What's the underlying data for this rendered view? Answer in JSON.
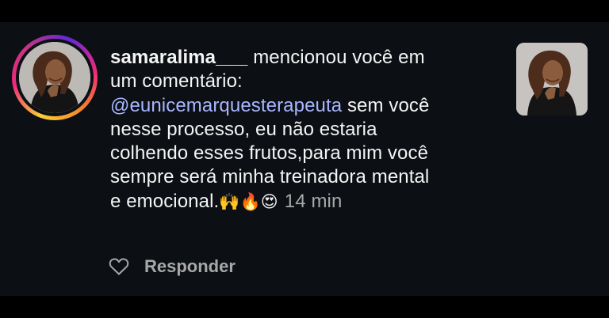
{
  "notification": {
    "username": "samaralima___",
    "action_text": " mencionou você em",
    "action_text_2": "um comentário:",
    "mention": "@eunicemarquesterapeuta",
    "comment_line_1": " sem você",
    "comment_line_2": "nesse processo, eu não estaria",
    "comment_line_3": "colhendo esses frutos,para mim você",
    "comment_line_4": "sempre será minha treinadora mental",
    "comment_line_5": "e emocional.",
    "emojis": [
      "🙌",
      "🔥",
      "😍"
    ],
    "time": "14 min"
  },
  "actions": {
    "reply_label": "Responder",
    "like_icon": "heart-outline-icon"
  },
  "colors": {
    "background": "#0c0f14",
    "text": "#f5f5f5",
    "mention": "#a8b6ff",
    "muted": "#a8a8a8"
  }
}
